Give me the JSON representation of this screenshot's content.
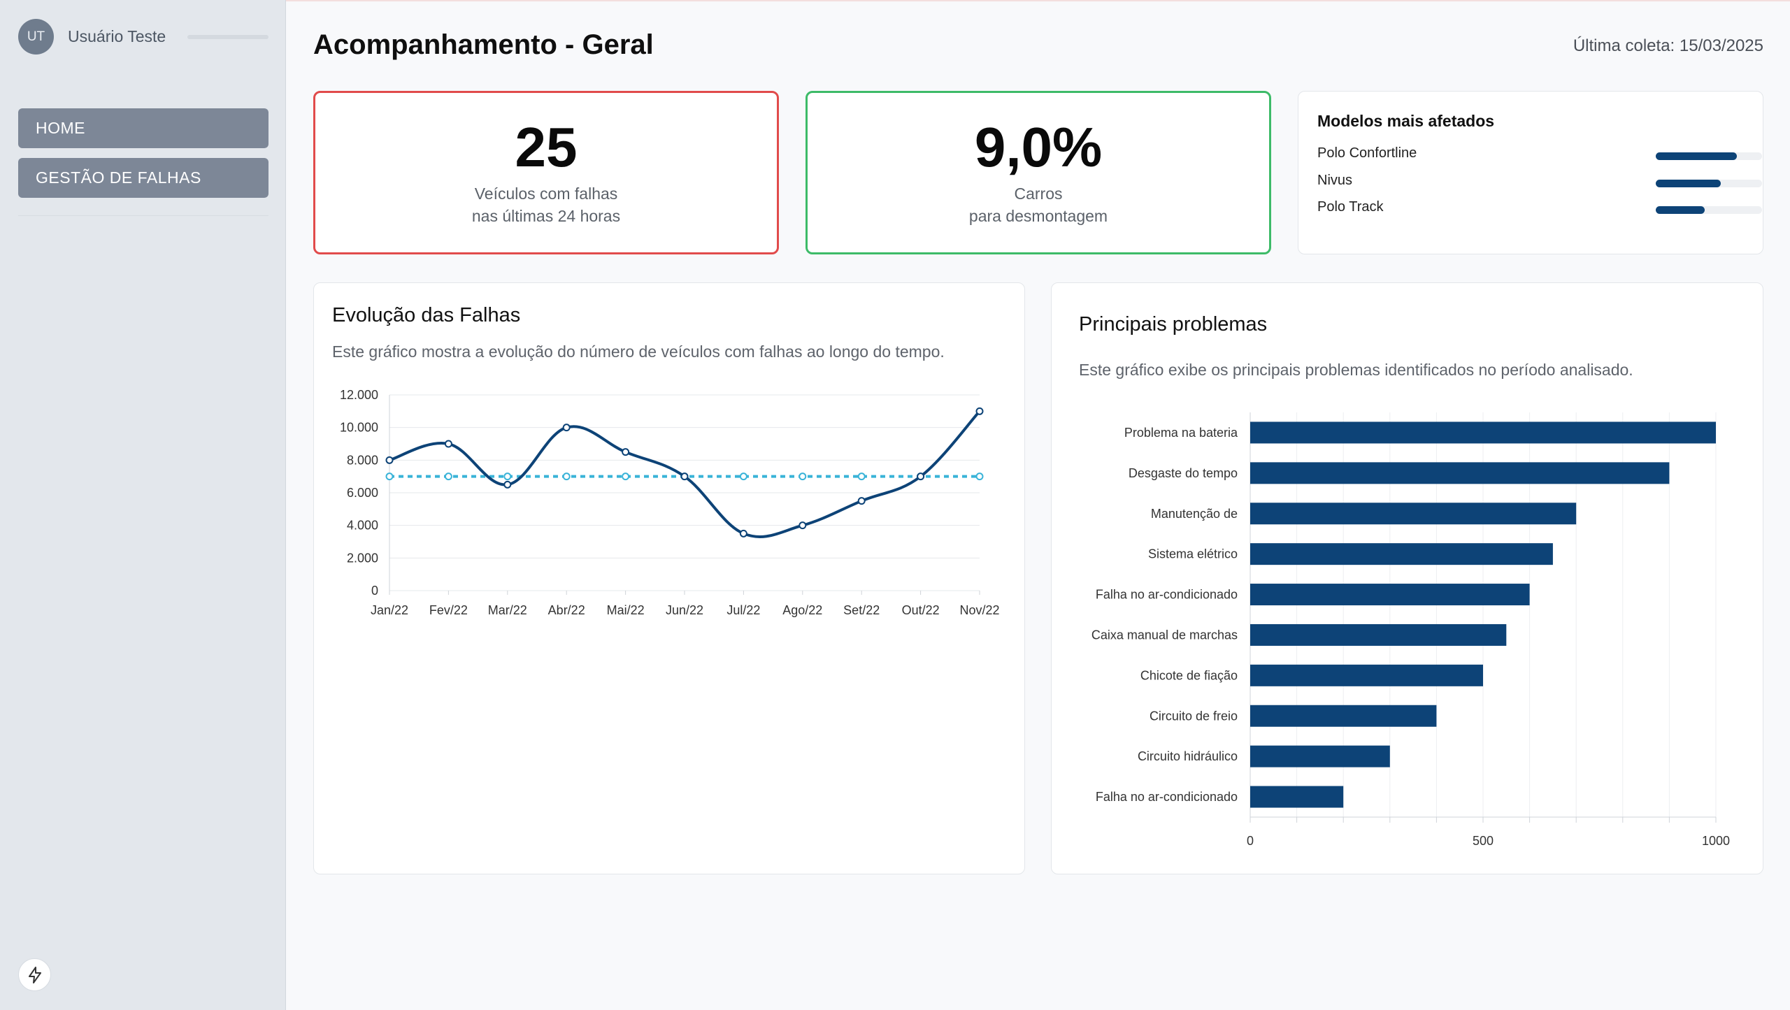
{
  "sidebar": {
    "avatar_initials": "UT",
    "user_name": "Usuário Teste",
    "nav": [
      {
        "label": "HOME"
      },
      {
        "label": "GESTÃO DE FALHAS"
      }
    ],
    "bottom_icon": "bolt-icon"
  },
  "header": {
    "title": "Acompanhamento - Geral",
    "last_collect": "Última coleta: 15/03/2025"
  },
  "kpis": [
    {
      "value": "25",
      "label_line1": "Veículos com falhas",
      "label_line2": "nas últimas 24 horas",
      "border_color": "#e14b4b"
    },
    {
      "value": "9,0%",
      "label_line1": "Carros",
      "label_line2": "para desmontagem",
      "border_color": "#3dbb68"
    }
  ],
  "models": {
    "title": "Modelos mais afetados",
    "items": [
      {
        "name": "Polo Confortline",
        "level": 0.76
      },
      {
        "name": "Nivus",
        "level": 0.61
      },
      {
        "name": "Polo Track",
        "level": 0.46
      }
    ]
  },
  "evolution": {
    "title": "Evolução das Falhas",
    "description": "Este gráfico mostra a evolução do número de veículos com falhas ao longo do tempo."
  },
  "problems": {
    "title": "Principais problemas",
    "description": "Este gráfico exibe os principais problemas identificados no período analisado."
  },
  "colors": {
    "primary": "#0d4377",
    "reference": "#39b3d8",
    "danger": "#e14b4b",
    "success": "#3dbb68"
  },
  "chart_data": [
    {
      "type": "line",
      "categories": [
        "Jan/22",
        "Fev/22",
        "Mar/22",
        "Abr/22",
        "Mai/22",
        "Jun/22",
        "Jul/22",
        "Ago/22",
        "Set/22",
        "Out/22",
        "Nov/22"
      ],
      "series": [
        {
          "values": [
            8000,
            9000,
            6500,
            10000,
            8500,
            7000,
            3500,
            4000,
            5500,
            7000,
            11000
          ]
        },
        {
          "values": [
            7000,
            7000,
            7000,
            7000,
            7000,
            7000,
            7000,
            7000,
            7000,
            7000,
            7000
          ],
          "style": "dashed"
        }
      ],
      "ylim": [
        0,
        12000
      ],
      "yticks": [
        "0",
        "2.000",
        "4.000",
        "6.000",
        "8.000",
        "10.000",
        "12.000"
      ],
      "ytick_values": [
        0,
        2000,
        4000,
        6000,
        8000,
        10000,
        12000
      ],
      "grid": true
    },
    {
      "type": "bar",
      "orientation": "horizontal",
      "categories": [
        "Problema na bateria",
        "Desgaste do tempo",
        "Manutenção de",
        "Sistema elétrico",
        "Falha no ar-condicionado",
        "Caixa manual de marchas",
        "Chicote de fiação",
        "Circuito de freio",
        "Circuito hidráulico",
        "Falha no ar-condicionado"
      ],
      "values": [
        1000,
        900,
        700,
        650,
        600,
        550,
        500,
        400,
        300,
        200
      ],
      "xlim": [
        0,
        1000
      ],
      "xticks": [
        "0",
        "500",
        "1000"
      ],
      "xtick_values": [
        0,
        500,
        1000
      ],
      "grid": true
    }
  ]
}
